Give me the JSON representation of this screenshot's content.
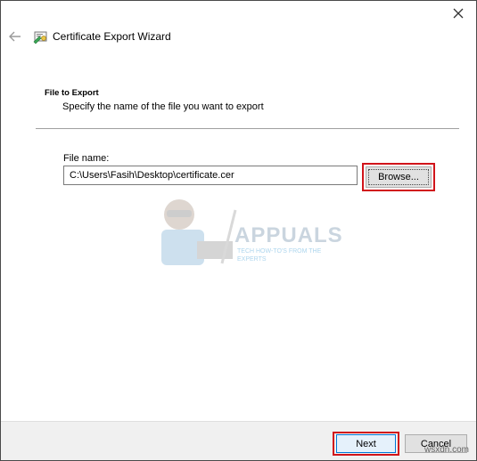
{
  "window": {
    "title": "Certificate Export Wizard",
    "close_glyph": "✕",
    "back_glyph": "←"
  },
  "page": {
    "heading": "File to Export",
    "subheading": "Specify the name of the file you want to export"
  },
  "file": {
    "label": "File name:",
    "value": "C:\\Users\\Fasih\\Desktop\\certificate.cer"
  },
  "buttons": {
    "browse": "Browse...",
    "next": "Next",
    "cancel": "Cancel"
  },
  "watermark": {
    "brand": "APPUALS",
    "tagline": "TECH HOW-TO'S FROM THE EXPERTS"
  },
  "site_mark": "wsxdn.com",
  "colors": {
    "highlight": "#d1141a",
    "accent": "#0078d7",
    "footer_bg": "#f0f0f0"
  }
}
